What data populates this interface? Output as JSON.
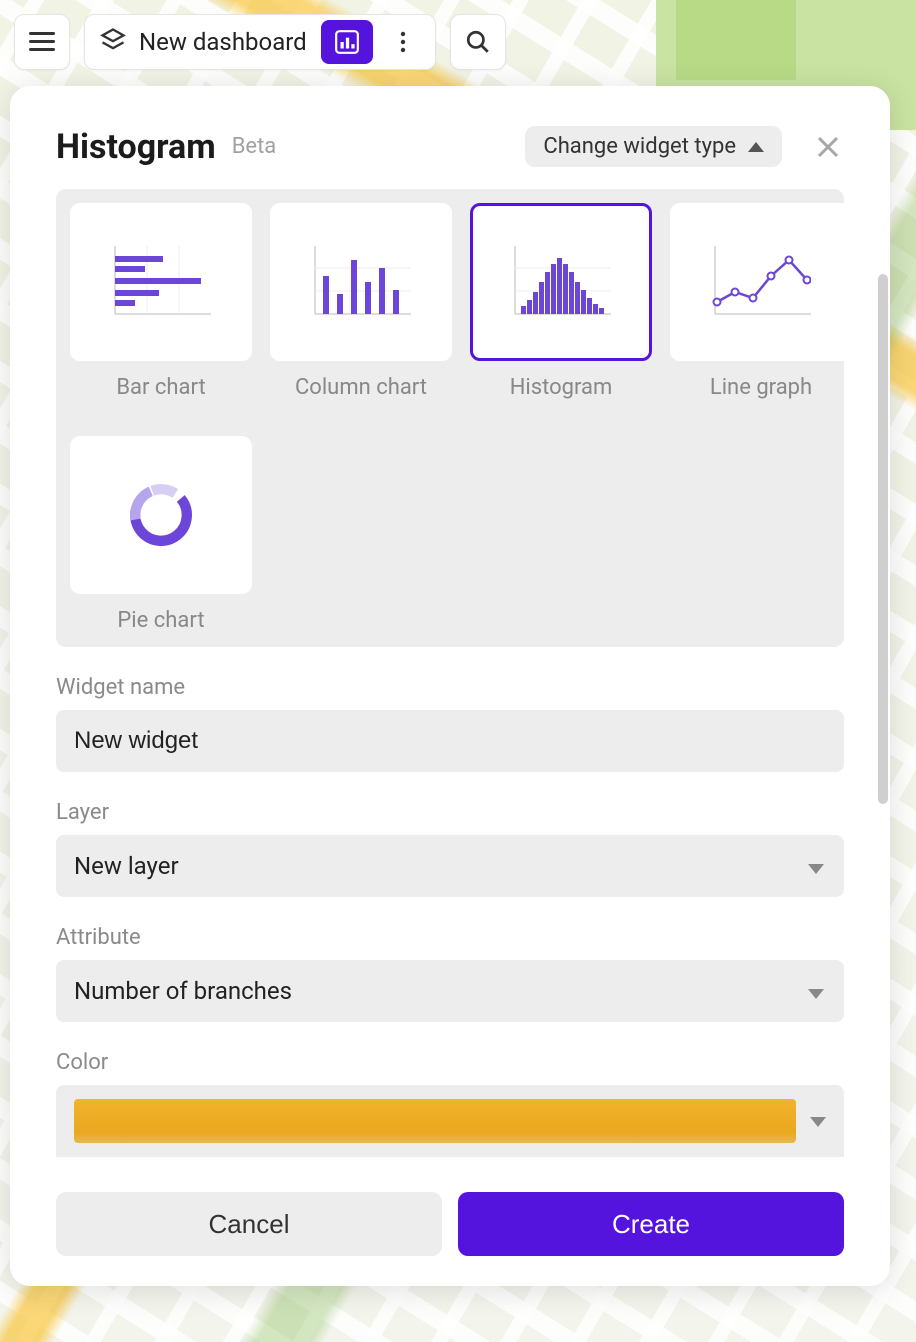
{
  "toolbar": {
    "dashboard_title": "New dashboard"
  },
  "panel": {
    "title": "Histogram",
    "beta_label": "Beta",
    "change_type_label": "Change widget type"
  },
  "widget_types": [
    {
      "id": "bar",
      "label": "Bar chart",
      "selected": false
    },
    {
      "id": "column",
      "label": "Column chart",
      "selected": false
    },
    {
      "id": "histogram",
      "label": "Histogram",
      "selected": true
    },
    {
      "id": "line",
      "label": "Line graph",
      "selected": false
    },
    {
      "id": "pie",
      "label": "Pie chart",
      "selected": false
    }
  ],
  "form": {
    "widget_name_label": "Widget name",
    "widget_name_value": "New widget",
    "layer_label": "Layer",
    "layer_value": "New layer",
    "attribute_label": "Attribute",
    "attribute_value": "Number of branches",
    "color_label": "Color",
    "color_value": "#eaa81e"
  },
  "footer": {
    "cancel_label": "Cancel",
    "create_label": "Create"
  },
  "colors": {
    "accent": "#5514dd"
  }
}
